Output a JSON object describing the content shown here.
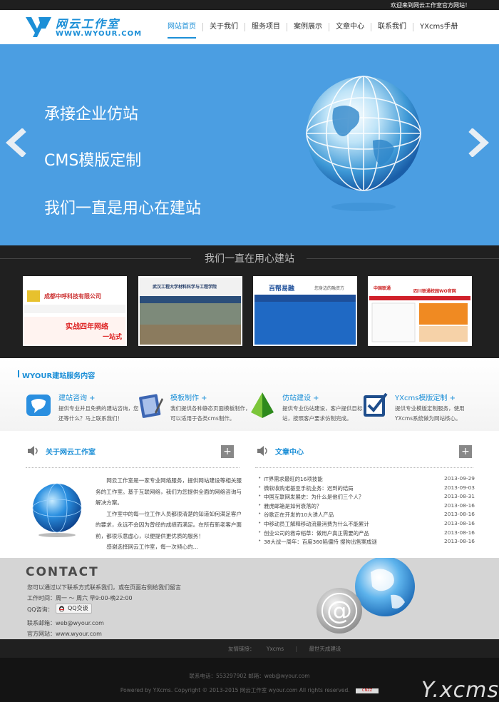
{
  "topbar": {
    "welcome": "欢迎来到网云工作室官方网站！"
  },
  "logo": {
    "cn": "网云工作室",
    "en": "WWW.WYOUR.COM"
  },
  "nav": [
    {
      "label": "网站首页",
      "active": true
    },
    {
      "label": "关于我们"
    },
    {
      "label": "服务项目"
    },
    {
      "label": "案例展示"
    },
    {
      "label": "文章中心"
    },
    {
      "label": "联系我们"
    },
    {
      "label": "YXcms手册"
    }
  ],
  "banner": {
    "lines": [
      "承接企业仿站",
      "CMS模版定制",
      "我们一直是用心在建站"
    ],
    "bg_color": "#4b9ee2"
  },
  "showcase": {
    "title": "我们一直在用心建站",
    "items": [
      {
        "caption": "成都中呼科技有限公司",
        "sub": "实战四年网络",
        "sub2": "一站式"
      },
      {
        "caption": "武汉工程大学材料科学与工程学院"
      },
      {
        "caption": "百帮易融",
        "sub": "您身边的融资方"
      },
      {
        "caption": "中国联通",
        "sub": "四川联通校园WO官网"
      }
    ]
  },
  "services": {
    "title": "WYOUR建站服务内容",
    "items": [
      {
        "title": "建站咨询 +",
        "desc": "提供专业并且免费的建站咨询，您还等什么？马上联系我们！",
        "icon": "chat-bubble-icon"
      },
      {
        "title": "模板制作 +",
        "desc": "我们提供各种静态页面模板制作，可以适用于各类cms制作。",
        "icon": "notebook-icon"
      },
      {
        "title": "仿站建设 +",
        "desc": "提供专业仿站建设，客户提供目标站，按照客户要求仿制完成。",
        "icon": "pyramid-icon"
      },
      {
        "title": "YXcms模版定制 +",
        "desc": "提供专业模版定制服务，使用YXcms系统做为网站核心。",
        "icon": "checkbox-icon"
      }
    ]
  },
  "about": {
    "title": "关于网云工作室",
    "paragraphs": [
      "网云工作室是一家专业网络服务，提供网站建设等相关服务的工作室。基于互联网络，我们为您提供全面的网络咨询与解决方案。",
      "工作室中的每一位工作人员都很清楚的知道如何满足客户的要求，永远不会因为曾经的成绩而满足。在所有新老客户面前，都很乐意虚心，以便提供更优质的服务！",
      "感谢选择网云工作室，每一次倾心的..."
    ]
  },
  "news": {
    "title": "文章中心",
    "items": [
      {
        "title": "IT界需求最旺的16项技能",
        "date": "2013-09-29"
      },
      {
        "title": "微软收购诺基亚手机业务：迟到的结局",
        "date": "2013-09-03"
      },
      {
        "title": "中国互联网发展史：为什么是他们三个人？",
        "date": "2013-08-31"
      },
      {
        "title": "雅虎邮箱是如何衰落的？",
        "date": "2013-08-16"
      },
      {
        "title": "谷歌正在开发的10大诱人产品",
        "date": "2013-08-16"
      },
      {
        "title": "中移动员工解释移动流量消费为什么不能累计",
        "date": "2013-08-16"
      },
      {
        "title": "创业公司的救命稻草：做用户真正需要的产品",
        "date": "2013-08-16"
      },
      {
        "title": "38大战一周年：百度360陷僵持 搜狗出售案成谜",
        "date": "2013-08-16"
      }
    ]
  },
  "contact": {
    "heading": "CONTACT",
    "intro": "您可以通过以下联系方式联系我们，或在页面右侧给我们留言",
    "hours": "工作时间：周一 ～ 周六 早9:00-晚22:00",
    "qq_label": "QQ咨询：",
    "qq_button": "QQ交谈",
    "email": "联系邮箱：web@wyour.com",
    "website": "官方网站：www.wyour.com"
  },
  "links": {
    "label": "友情链接：",
    "items": [
      "Yxcms",
      "最世天成建设"
    ]
  },
  "footer": {
    "contact_line": "联系电话：553297902   邮箱：web@wyour.com",
    "copyright": "Powered by YXcms. Copyright © 2013-2015 网云工作室 wyour.com All rights reserved.",
    "badge": "CNZZ",
    "brand": "Y.xcms"
  }
}
